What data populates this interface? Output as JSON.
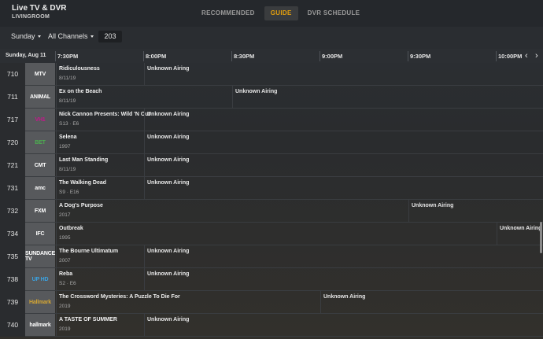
{
  "header": {
    "title": "Live TV & DVR",
    "subtitle": "LIVINGROOM",
    "tabs": [
      {
        "label": "RECOMMENDED",
        "active": false
      },
      {
        "label": "GUIDE",
        "active": true
      },
      {
        "label": "DVR SCHEDULE",
        "active": false
      }
    ]
  },
  "filters": {
    "day": "Sunday",
    "channels": "All Channels",
    "channel_jump": "203"
  },
  "timeline": {
    "date": "Sunday, Aug 11",
    "slots": [
      "7:30PM",
      "8:00PM",
      "8:30PM",
      "9:00PM",
      "9:30PM",
      "10:00PM"
    ],
    "prev_icon": "chevron-left-icon",
    "next_icon": "chevron-right-icon"
  },
  "unknown_label": "Unknown Airing",
  "rows": [
    {
      "channel": "710",
      "logo": "MTV",
      "title": "Ridiculousness",
      "meta": "8/11/19",
      "unknown_at": 1
    },
    {
      "channel": "711",
      "logo": "ANIMAL",
      "title": "Ex on the Beach",
      "meta": "8/11/19",
      "unknown_at": 2
    },
    {
      "channel": "717",
      "logo": "VH1",
      "title": "Nick Cannon Presents: Wild 'N Out",
      "meta": "S13 · E6",
      "unknown_at": 1
    },
    {
      "channel": "720",
      "logo": "BET",
      "title": "Selena",
      "meta": "1997",
      "unknown_at": 1
    },
    {
      "channel": "721",
      "logo": "CMT",
      "title": "Last Man Standing",
      "meta": "8/11/19",
      "unknown_at": 1
    },
    {
      "channel": "731",
      "logo": "amc",
      "title": "The Walking Dead",
      "meta": "S9 · E16",
      "unknown_at": 1
    },
    {
      "channel": "732",
      "logo": "FXM",
      "title": "A Dog's Purpose",
      "meta": "2017",
      "unknown_at": 4
    },
    {
      "channel": "734",
      "logo": "IFC",
      "title": "Outbreak",
      "meta": "1995",
      "unknown_at": 5
    },
    {
      "channel": "735",
      "logo": "SUNDANCE TV",
      "title": "The Bourne Ultimatum",
      "meta": "2007",
      "unknown_at": 1
    },
    {
      "channel": "738",
      "logo": "UP HD",
      "title": "Reba",
      "meta": "S2 · E6",
      "unknown_at": 1
    },
    {
      "channel": "739",
      "logo": "Hallmark",
      "title": "The Crossword Mysteries: A Puzzle To Die For",
      "meta": "2019",
      "unknown_at": 3
    },
    {
      "channel": "740",
      "logo": "hallmark",
      "title": "A TASTE OF SUMMER",
      "meta": "2019",
      "unknown_at": 1
    }
  ],
  "colors": {
    "accent": "#e5a00d",
    "vh1": "#c6168d",
    "bet": "#4caf50",
    "up": "#3aa3e3",
    "hallmark": "#d4a634"
  }
}
